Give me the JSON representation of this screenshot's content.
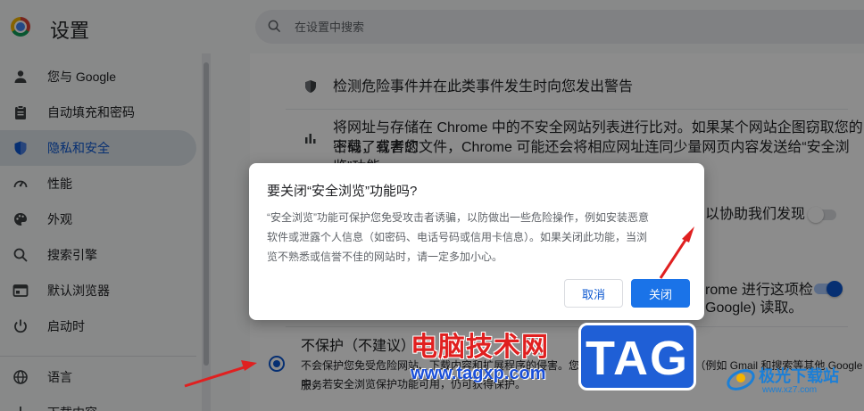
{
  "header": {
    "title": "设置",
    "search_placeholder": "在设置中搜索"
  },
  "sidebar": {
    "items": [
      {
        "label": "您与 Google",
        "icon": "person-icon"
      },
      {
        "label": "自动填充和密码",
        "icon": "clipboard-icon"
      },
      {
        "label": "隐私和安全",
        "icon": "shield-icon",
        "active": true
      },
      {
        "label": "性能",
        "icon": "speedometer-icon"
      },
      {
        "label": "外观",
        "icon": "palette-icon"
      },
      {
        "label": "搜索引擎",
        "icon": "search-icon"
      },
      {
        "label": "默认浏览器",
        "icon": "browser-window-icon"
      },
      {
        "label": "启动时",
        "icon": "power-icon"
      },
      {
        "label": "语言",
        "icon": "globe-icon"
      },
      {
        "label": "下载内容",
        "icon": "download-icon"
      }
    ]
  },
  "main": {
    "row1": "检测危险事件并在此类事件发生时向您发出警告",
    "row2_line1": "将网址与存储在 Chrome 中的不安全网站列表进行比对。如果某个网站企图窃取您的密码，或者您",
    "row2_line2": "下载了有害的文件，Chrome 可能还会将相应网址连同少量网页内容发送给“安全浏览”功能。",
    "row3_right": "以协助我们发现",
    "row4_right_line1": "rome 进行这项检",
    "row4_right_line2": "Google) 读取。",
    "no_protection_title": "不保护（不建议）",
    "no_protection_desc_line1": "不会保护您免受危险网站、下载内容和扩展程序的侵害。您仍可在其他 Google 服务（例如 Gmail 和搜索等其他 Google 服务",
    "no_protection_desc_line2": "中，若安全浏览保护功能可用，仍可获得保护。"
  },
  "dialog": {
    "title": "要关闭“安全浏览”功能吗?",
    "body_line1": "“安全浏览”功能可保护您免受攻击者诱骗，以防做出一些危险操作，例如安装恶意",
    "body_line2": "软件或泄露个人信息（如密码、电话号码或信用卡信息）。如果关闭此功能，当浏",
    "body_line3": "览不熟悉或信誉不佳的网站时，请一定多加小心。",
    "cancel_label": "取消",
    "confirm_label": "关闭"
  },
  "watermarks": {
    "site_name": "电脑技术网",
    "site_url": "www.tagxp.com",
    "tag_badge": "TAG",
    "brand2_name": "极光下载站",
    "brand2_url": "www.xz7.com"
  },
  "colors": {
    "accent": "#0b57d0",
    "button_blue": "#1a73e8",
    "arrow_red": "#e02020",
    "sidebar_active_bg": "#dde3ea"
  }
}
